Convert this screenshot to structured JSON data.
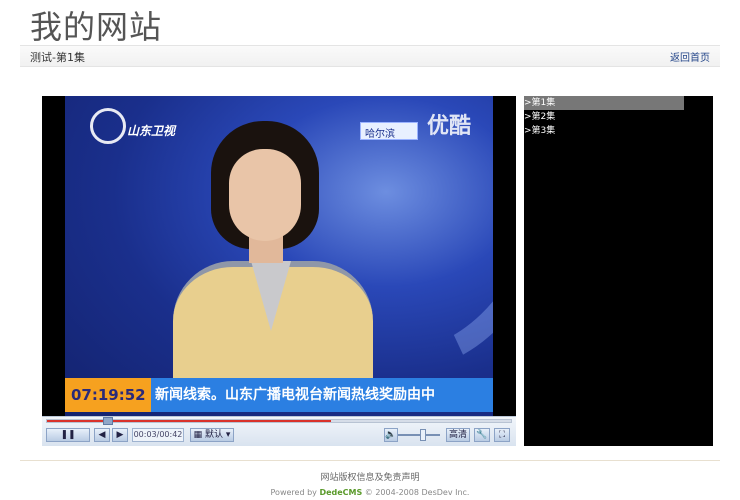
{
  "site": {
    "title": "我的网站"
  },
  "crumb": {
    "text": "测试-第1集",
    "home_link": "返回首页"
  },
  "video": {
    "channel_logo": "山东卫视",
    "location_tag": "哈尔滨",
    "watermark": "优酷",
    "ticker_time": "07:19:52",
    "ticker_text": "新闻线索。山东广播电视台新闻热线奖励由中"
  },
  "player_controls": {
    "play_pause_icon": "pause-icon",
    "current_time": "00:03/00:42",
    "quality_default": "默认",
    "hd_label": "高清",
    "progress_fraction": 0.61,
    "buffer_knob_fraction": 0.12,
    "volume_fraction": 0.6
  },
  "episodes": [
    {
      "label": ">第1集"
    },
    {
      "label": ">第2集"
    },
    {
      "label": ">第3集"
    }
  ],
  "footer": {
    "info": "网站版权信息及免责声明",
    "powered_prefix": "Powered by ",
    "powered_brand": "DedeCMS",
    "powered_suffix": " © 2004-2008 DesDev Inc."
  },
  "colors": {
    "accent_red": "#d9322b",
    "control_blue": "#8ca3c6",
    "ticker_orange": "#f6a11f",
    "ticker_blue": "#2b7fe2"
  }
}
